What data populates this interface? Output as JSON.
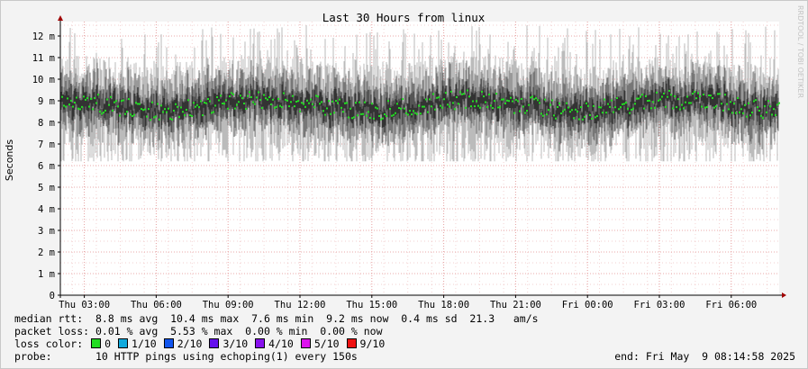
{
  "chart_data": {
    "type": "area",
    "title": "Last 30 Hours from linux",
    "ylabel": "Seconds",
    "watermark": "RRDTOOL / TOBI OETIKER",
    "ylim": [
      0,
      12.5
    ],
    "y_ticks": [
      {
        "value": 0,
        "label": "0"
      },
      {
        "value": 1,
        "label": "1 m"
      },
      {
        "value": 2,
        "label": "2 m"
      },
      {
        "value": 3,
        "label": "3 m"
      },
      {
        "value": 4,
        "label": "4 m"
      },
      {
        "value": 5,
        "label": "5 m"
      },
      {
        "value": 6,
        "label": "6 m"
      },
      {
        "value": 7,
        "label": "7 m"
      },
      {
        "value": 8,
        "label": "8 m"
      },
      {
        "value": 9,
        "label": "9 m"
      },
      {
        "value": 10,
        "label": "10 m"
      },
      {
        "value": 11,
        "label": "11 m"
      },
      {
        "value": 12,
        "label": "12 m"
      }
    ],
    "x_range_hours": [
      0,
      30
    ],
    "x_ticks": [
      {
        "hour": 1,
        "label": "Thu 03:00"
      },
      {
        "hour": 4,
        "label": "Thu 06:00"
      },
      {
        "hour": 7,
        "label": "Thu 09:00"
      },
      {
        "hour": 10,
        "label": "Thu 12:00"
      },
      {
        "hour": 13,
        "label": "Thu 15:00"
      },
      {
        "hour": 16,
        "label": "Thu 18:00"
      },
      {
        "hour": 19,
        "label": "Thu 21:00"
      },
      {
        "hour": 22,
        "label": "Fri 00:00"
      },
      {
        "hour": 25,
        "label": "Fri 03:00"
      },
      {
        "hour": 28,
        "label": "Fri 06:00"
      }
    ],
    "series": [
      {
        "name": "median rtt",
        "median_ms": 8.8,
        "spread_low_ms": 6.5,
        "spread_high_ms": 12.5,
        "color": "#22dd22"
      }
    ],
    "grid": true,
    "grid_color": "#e6a0a0"
  },
  "legend": {
    "median_rtt": "median rtt:  8.8 ms avg  10.4 ms max  7.6 ms min  9.2 ms now  0.4 ms sd  21.3   am/s",
    "packet_loss": "packet loss: 0.01 % avg  5.53 % max  0.00 % min  0.00 % now",
    "loss_color_label": "loss color: ",
    "loss_colors": [
      {
        "label": "0",
        "color": "#22dd22"
      },
      {
        "label": "1/10",
        "color": "#11aadd"
      },
      {
        "label": "2/10",
        "color": "#1155ee"
      },
      {
        "label": "3/10",
        "color": "#6611ee"
      },
      {
        "label": "4/10",
        "color": "#8811ee"
      },
      {
        "label": "5/10",
        "color": "#dd11ee"
      },
      {
        "label": "9/10",
        "color": "#ee1111"
      }
    ],
    "probe": "probe:       10 HTTP pings using echoping(1) every 150s",
    "end": "end: Fri May  9 08:14:58 2025"
  }
}
